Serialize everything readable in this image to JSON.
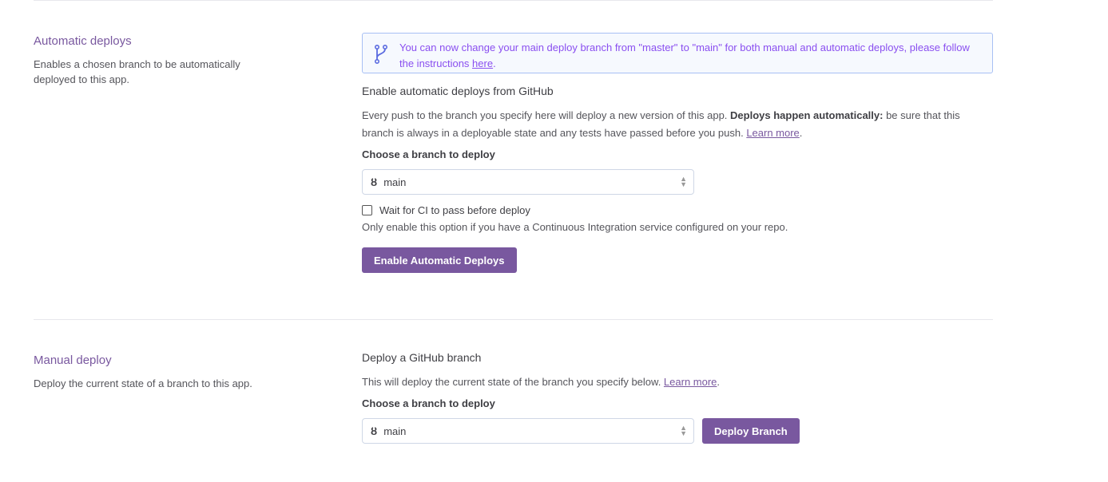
{
  "auto": {
    "title": "Automatic deploys",
    "description": "Enables a chosen branch to be automatically deployed to this app.",
    "banner_text": "You can now change your main deploy branch from \"master\" to \"main\" for both manual and automatic deploys, please follow the instructions ",
    "banner_link": "here",
    "banner_end": ".",
    "heading": "Enable automatic deploys from GitHub",
    "desc_1": "Every push to the branch you specify here will deploy a new version of this app. ",
    "desc_bold": "Deploys happen automatically:",
    "desc_2": " be sure that this branch is always in a deployable state and any tests have passed before you push. ",
    "learn_more": "Learn more",
    "period": ".",
    "branch_label": "Choose a branch to deploy",
    "branch": "main",
    "ci_label": "Wait for CI to pass before deploy",
    "ci_help": "Only enable this option if you have a Continuous Integration service configured on your repo.",
    "button": "Enable Automatic Deploys"
  },
  "manual": {
    "title": "Manual deploy",
    "description": "Deploy the current state of a branch to this app.",
    "heading": "Deploy a GitHub branch",
    "desc": "This will deploy the current state of the branch you specify below. ",
    "learn_more": "Learn more",
    "period": ".",
    "branch_label": "Choose a branch to deploy",
    "branch": "main",
    "button": "Deploy Branch"
  }
}
